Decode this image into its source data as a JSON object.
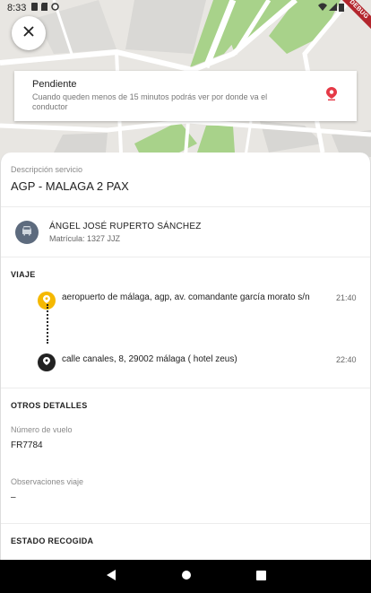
{
  "status_bar": {
    "time": "8:33",
    "ribbon": "DEBUG"
  },
  "pending": {
    "title": "Pendiente",
    "description": "Cuando queden menos de 15 minutos podrás ver por donde va el conductor"
  },
  "service": {
    "label": "Descripción servicio",
    "name": "AGP - MALAGA 2 PAX"
  },
  "driver": {
    "name": "ÁNGEL JOSÉ RUPERTO SÁNCHEZ",
    "plate": "Matrícula: 1327 JJZ"
  },
  "trip": {
    "title": "VIAJE",
    "stops": [
      {
        "address": "aeropuerto de málaga, agp, av. comandante garcía morato s/n",
        "time": "21:40",
        "color": "#f5b800"
      },
      {
        "address": "calle canales, 8, 29002 málaga ( hotel zeus)",
        "time": "22:40",
        "color": "#222222"
      }
    ]
  },
  "other": {
    "title": "OTROS DETALLES",
    "flight_label": "Número de vuelo",
    "flight_value": "FR7784",
    "notes_label": "Observaciones viaje",
    "notes_value": "–"
  },
  "estado": {
    "title": "ESTADO RECOGIDA"
  },
  "colors": {
    "map_green": "#a8d28a",
    "avatar": "#5d6b7e",
    "pin_red": "#e53946"
  }
}
